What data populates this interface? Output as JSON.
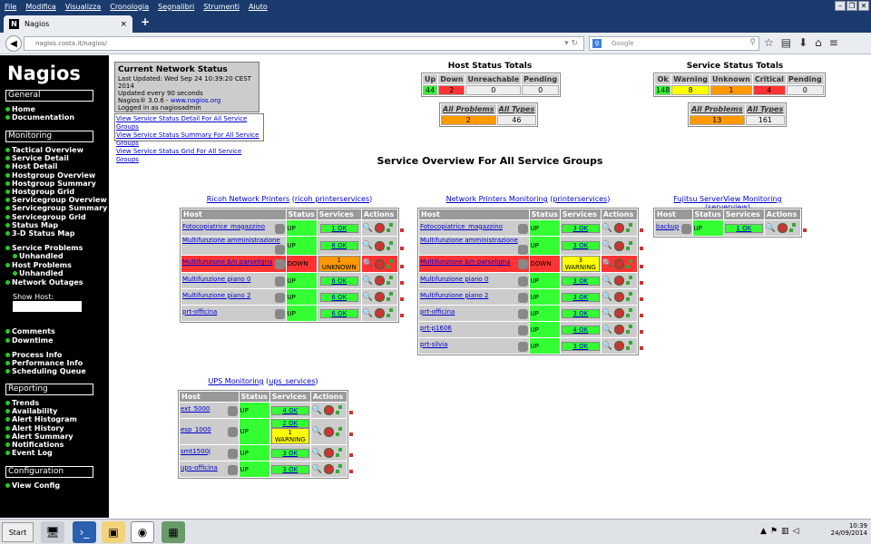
{
  "browser": {
    "menu": [
      "File",
      "Modifica",
      "Visualizza",
      "Cronologia",
      "Segnalibri",
      "Strumenti",
      "Aiuto"
    ],
    "tab_title": "Nagios",
    "tab_icon": "N",
    "url": "nagios.costa.it/nagios/",
    "search_placeholder": "Google"
  },
  "sidebar": {
    "logo": "Nagios",
    "sections": {
      "general": "General",
      "monitoring": "Monitoring",
      "reporting": "Reporting",
      "configuration": "Configuration"
    },
    "general": [
      "Home",
      "Documentation"
    ],
    "monitoring": [
      "Tactical Overview",
      "Service Detail",
      "Host Detail",
      "Hostgroup Overview",
      "Hostgroup Summary",
      "Hostgroup Grid",
      "Servicegroup Overview",
      "Servicegroup Summary",
      "Servicegroup Grid",
      "Status Map",
      "3-D Status Map"
    ],
    "problems": [
      "Service Problems",
      "Unhandled",
      "Host Problems",
      "Unhandled",
      "Network Outages"
    ],
    "show_host": "Show Host:",
    "misc": [
      "Comments",
      "Downtime",
      "Process Info",
      "Performance Info",
      "Scheduling Queue"
    ],
    "reporting": [
      "Trends",
      "Availability",
      "Alert Histogram",
      "Alert History",
      "Alert Summary",
      "Notifications",
      "Event Log"
    ],
    "configuration": [
      "View Config"
    ]
  },
  "status": {
    "title": "Current Network Status",
    "updated": "Last Updated: Wed Sep 24 10:39:20 CEST 2014",
    "every": "Updated every 90 seconds",
    "version_pre": "Nagios® 3.0.6 - ",
    "version_link": "www.nagios.org",
    "logged": "Logged in as nagiosadmin",
    "links": [
      "View Service Status Detail For All Service Groups",
      "View Service Status Summary For All Service Groups",
      "View Service Status Grid For All Service Groups"
    ]
  },
  "host_totals": {
    "title": "Host Status Totals",
    "headers": [
      "Up",
      "Down",
      "Unreachable",
      "Pending"
    ],
    "values": [
      "44",
      "2",
      "0",
      "0"
    ],
    "all_headers": [
      "All Problems",
      "All Types"
    ],
    "all_values": [
      "2",
      "46"
    ]
  },
  "service_totals": {
    "title": "Service Status Totals",
    "headers": [
      "Ok",
      "Warning",
      "Unknown",
      "Critical",
      "Pending"
    ],
    "values": [
      "148",
      "8",
      "1",
      "4",
      "0"
    ],
    "all_headers": [
      "All Problems",
      "All Types"
    ],
    "all_values": [
      "13",
      "161"
    ]
  },
  "overview_title": "Service Overview For All Service Groups",
  "table_headers": [
    "Host",
    "Status",
    "Services",
    "Actions"
  ],
  "groups": [
    {
      "name": "Ricoh Network Printers",
      "id": "ricoh printerservices",
      "rows": [
        {
          "host": "Fotocopiatrice_magazzino",
          "status": "UP",
          "svc": "1 OK"
        },
        {
          "host": "Multifunzione amministrazione",
          "status": "UP",
          "svc": "8 OK"
        },
        {
          "host": "Multifunzione b/n parseligna",
          "status": "DOWN",
          "svc": "1 UNKNOWN"
        },
        {
          "host": "Multifunzione piano 0",
          "status": "UP",
          "svc": "6 OK"
        },
        {
          "host": "Multifunzione piano 2",
          "status": "UP",
          "svc": "6 OK"
        },
        {
          "host": "prt-officina",
          "status": "UP",
          "svc": "6 OK"
        }
      ]
    },
    {
      "name": "Network Printers Monitoring",
      "id": "printerservices",
      "rows": [
        {
          "host": "Fotocopiatrice_magazzino",
          "status": "UP",
          "svc": "3 OK"
        },
        {
          "host": "Multifunzione amministrazione",
          "status": "UP",
          "svc": "3 OK"
        },
        {
          "host": "Multifunzione b/n parseligna",
          "status": "DOWN",
          "svc": "3 WARNING"
        },
        {
          "host": "Multifunzione piano 0",
          "status": "UP",
          "svc": "3 OK"
        },
        {
          "host": "Multifunzione piano 2",
          "status": "UP",
          "svc": "3 OK"
        },
        {
          "host": "prt-officina",
          "status": "UP",
          "svc": "3 OK"
        },
        {
          "host": "prt-p1606",
          "status": "UP",
          "svc": "4 OK"
        },
        {
          "host": "prt-silvia",
          "status": "UP",
          "svc": "3 OK"
        }
      ]
    },
    {
      "name": "Fujitsu ServerView Monitoring",
      "id": "serverview",
      "rows": [
        {
          "host": "backup",
          "status": "UP",
          "svc": "1 OK"
        }
      ]
    },
    {
      "name": "UPS Monitoring",
      "id": "ups_services",
      "rows": [
        {
          "host": "ext_5000",
          "status": "UP",
          "svc": "4 OK"
        },
        {
          "host": "esp_1000",
          "status": "UP",
          "svc": "2 OK",
          "svc2": "1 WARNING"
        },
        {
          "host": "smt1500j",
          "status": "UP",
          "svc": "3 OK"
        },
        {
          "host": "ups-officina",
          "status": "UP",
          "svc": "3 OK"
        }
      ]
    }
  ],
  "taskbar": {
    "start": "Start",
    "time": "10:39",
    "date": "24/09/2014"
  }
}
